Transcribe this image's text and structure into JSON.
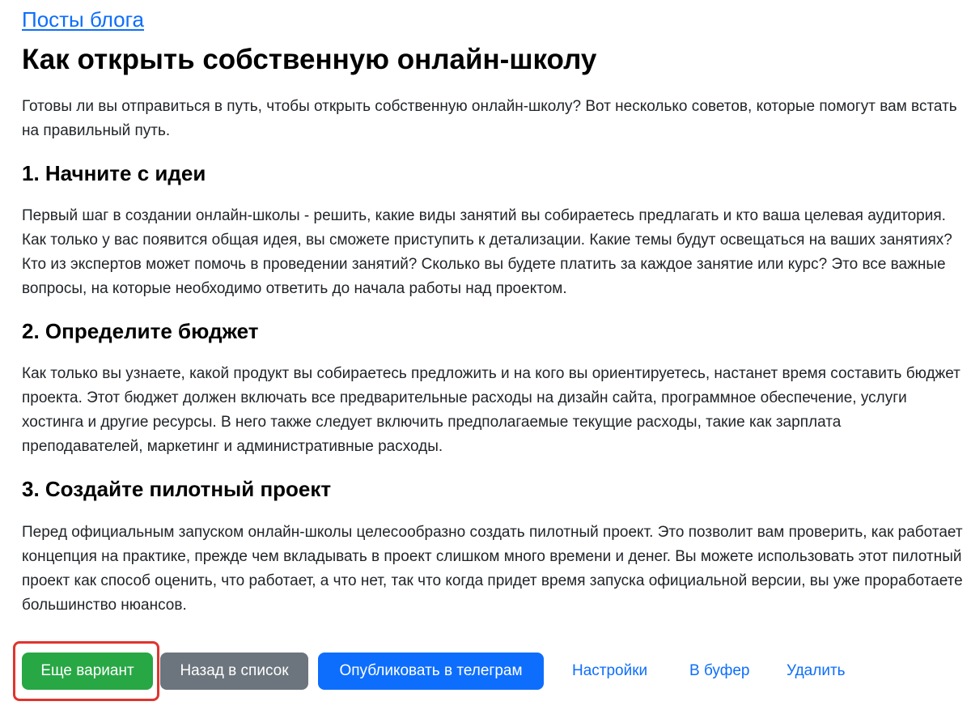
{
  "breadcrumb": {
    "link_label": "Посты блога"
  },
  "article": {
    "title": "Как открыть собственную онлайн-школу",
    "intro": "Готовы ли вы отправиться в путь, чтобы открыть собственную онлайн-школу? Вот несколько советов, которые помогут вам встать на правильный путь.",
    "sections": [
      {
        "heading": "1. Начните с идеи",
        "body": "Первый шаг в создании онлайн-школы - решить, какие виды занятий вы собираетесь предлагать и кто ваша целевая аудитория. Как только у вас появится общая идея, вы сможете приступить к детализации. Какие темы будут освещаться на ваших занятиях? Кто из экспертов может помочь в проведении занятий? Сколько вы будете платить за каждое занятие или курс? Это все важные вопросы, на которые необходимо ответить до начала работы над проектом."
      },
      {
        "heading": "2. Определите бюджет",
        "body": "Как только вы узнаете, какой продукт вы собираетесь предложить и на кого вы ориентируетесь, настанет время составить бюджет проекта. Этот бюджет должен включать все предварительные расходы на дизайн сайта, программное обеспечение, услуги хостинга и другие ресурсы. В него также следует включить предполагаемые текущие расходы, такие как зарплата преподавателей, маркетинг и административные расходы."
      },
      {
        "heading": "3. Создайте пилотный проект",
        "body": "Перед официальным запуском онлайн-школы целесообразно создать пилотный проект. Это позволит вам проверить, как работает концепция на практике, прежде чем вкладывать в проект слишком много времени и денег. Вы можете использовать этот пилотный проект как способ оценить, что работает, а что нет, так что когда придет время запуска официальной версии, вы уже проработаете большинство нюансов."
      }
    ]
  },
  "actions": {
    "another_variant_label": "Еще вариант",
    "back_to_list_label": "Назад в список",
    "publish_telegram_label": "Опубликовать в телеграм",
    "settings_label": "Настройки",
    "to_buffer_label": "В буфер",
    "delete_label": "Удалить"
  },
  "colors": {
    "link": "#0d6efd",
    "success": "#28a745",
    "secondary": "#6c757d",
    "primary": "#0d6efd",
    "highlight": "#e0342f"
  }
}
